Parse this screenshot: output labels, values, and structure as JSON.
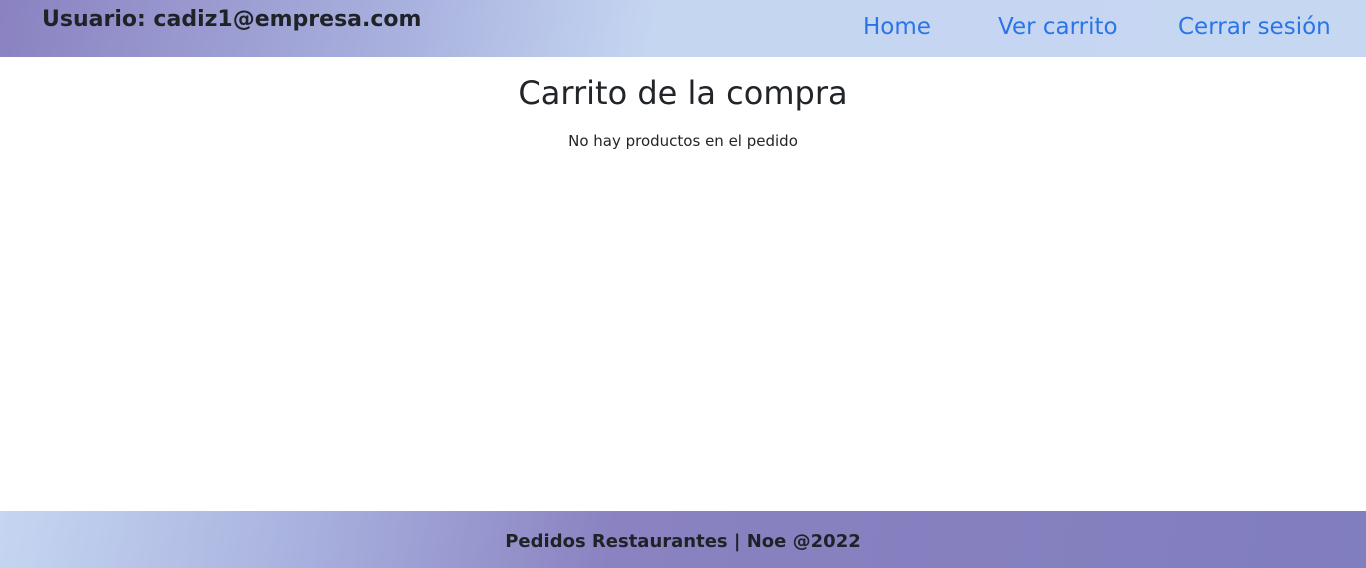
{
  "header": {
    "user_label": "Usuario: cadiz1@empresa.com",
    "nav": {
      "home": "Home",
      "cart": "Ver carrito",
      "logout": "Cerrar sesión"
    }
  },
  "main": {
    "title": "Carrito de la compra",
    "empty_message": "No hay productos en el pedido"
  },
  "footer": {
    "text": "Pedidos Restaurantes | Noe @2022"
  },
  "colors": {
    "link": "#2b74e6",
    "bar_purple": "#8a82c1",
    "bar_blue": "#c6d7f2"
  }
}
